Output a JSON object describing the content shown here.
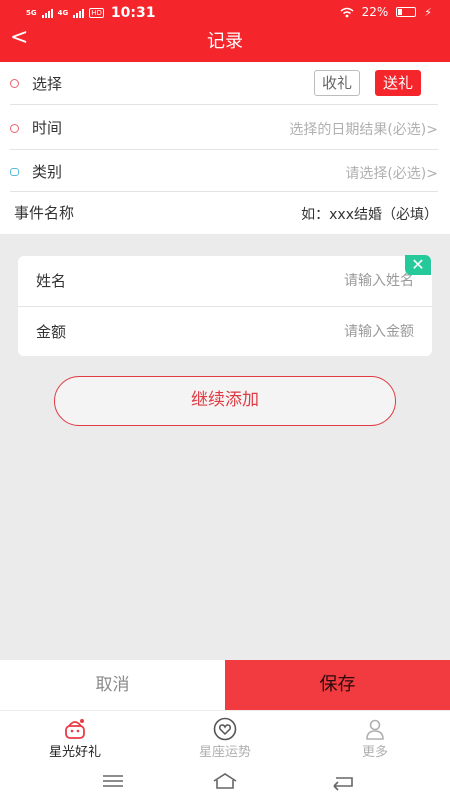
{
  "status": {
    "network_1": "5G",
    "network_2": "4G",
    "hd": "HD",
    "time": "10:31",
    "battery": "22%"
  },
  "header": {
    "title": "记录",
    "back_icon": "<"
  },
  "form": {
    "select": {
      "label": "选择",
      "option_receive": "收礼",
      "option_send": "送礼",
      "selected": "送礼"
    },
    "time": {
      "label": "时间",
      "placeholder": "选择的日期结果(必选)>"
    },
    "category": {
      "label": "类别",
      "placeholder": "请选择(必选)>"
    },
    "event": {
      "label": "事件名称",
      "placeholder": "如：xxx结婚（必填）"
    }
  },
  "card": {
    "name": {
      "label": "姓名",
      "placeholder": "请输入姓名"
    },
    "amount": {
      "label": "金额",
      "placeholder": "请输入金额"
    },
    "close_icon": "✕"
  },
  "continue_label": "继续添加",
  "actions": {
    "cancel": "取消",
    "save": "保存"
  },
  "tabs": [
    {
      "label": "星光好礼",
      "icon": "gift-robot-icon",
      "active": true
    },
    {
      "label": "星座运势",
      "icon": "heart-icon",
      "active": false
    },
    {
      "label": "更多",
      "icon": "user-icon",
      "active": false
    }
  ],
  "colors": {
    "brand": "#f4252b",
    "save": "#f23b40",
    "badge": "#26c99a"
  }
}
